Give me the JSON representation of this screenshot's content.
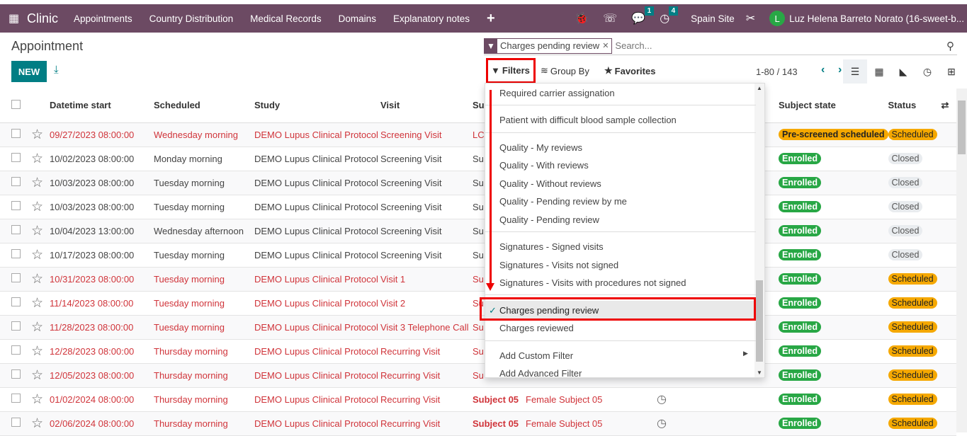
{
  "nav": {
    "app": "Clinic",
    "menus": [
      "Appointments",
      "Country Distribution",
      "Medical Records",
      "Domains",
      "Explanatory notes"
    ],
    "messages_count": "1",
    "activities_count": "4",
    "site": "Spain Site",
    "avatar_letter": "L",
    "user": "Luz Helena Barreto Norato (16-sweet-b..."
  },
  "page": {
    "title": "Appointment",
    "new_label": "NEW"
  },
  "search": {
    "facet": "Charges pending review",
    "placeholder": "Search..."
  },
  "controls": {
    "filters": "Filters",
    "group_by": "Group By",
    "favorites": "Favorites",
    "pager": "1-80 / 143"
  },
  "table": {
    "headers": [
      "Datetime start",
      "Scheduled",
      "Study",
      "Visit",
      "Su",
      "",
      "",
      "Subject state",
      "Status"
    ],
    "rows": [
      {
        "red": true,
        "date": "09/27/2023 08:00:00",
        "scheduled": "Wednesday morning",
        "study": "DEMO Lupus Clinical Protocol",
        "visit": "Screening Visit",
        "subject": "LC",
        "sex": "",
        "clock": false,
        "state": "Pre-screened scheduled",
        "status": "Scheduled"
      },
      {
        "red": false,
        "date": "10/02/2023 08:00:00",
        "scheduled": "Monday morning",
        "study": "DEMO Lupus Clinical Protocol",
        "visit": "Screening Visit",
        "subject": "Su",
        "sex": "",
        "clock": false,
        "state": "Enrolled",
        "status": "Closed"
      },
      {
        "red": false,
        "date": "10/03/2023 08:00:00",
        "scheduled": "Tuesday morning",
        "study": "DEMO Lupus Clinical Protocol",
        "visit": "Screening Visit",
        "subject": "Su",
        "sex": "",
        "clock": false,
        "state": "Enrolled",
        "status": "Closed"
      },
      {
        "red": false,
        "date": "10/03/2023 08:00:00",
        "scheduled": "Tuesday morning",
        "study": "DEMO Lupus Clinical Protocol",
        "visit": "Screening Visit",
        "subject": "Su",
        "sex": "",
        "clock": false,
        "state": "Enrolled",
        "status": "Closed"
      },
      {
        "red": false,
        "date": "10/04/2023 13:00:00",
        "scheduled": "Wednesday afternoon",
        "study": "DEMO Lupus Clinical Protocol",
        "visit": "Screening Visit",
        "subject": "Su",
        "sex": "",
        "clock": false,
        "state": "Enrolled",
        "status": "Closed"
      },
      {
        "red": false,
        "date": "10/17/2023 08:00:00",
        "scheduled": "Tuesday morning",
        "study": "DEMO Lupus Clinical Protocol",
        "visit": "Screening Visit",
        "subject": "Su",
        "sex": "",
        "clock": false,
        "state": "Enrolled",
        "status": "Closed"
      },
      {
        "red": true,
        "date": "10/31/2023 08:00:00",
        "scheduled": "Tuesday morning",
        "study": "DEMO Lupus Clinical Protocol",
        "visit": "Visit 1",
        "subject": "Su",
        "sex": "",
        "clock": false,
        "state": "Enrolled",
        "status": "Scheduled"
      },
      {
        "red": true,
        "date": "11/14/2023 08:00:00",
        "scheduled": "Tuesday morning",
        "study": "DEMO Lupus Clinical Protocol",
        "visit": "Visit 2",
        "subject": "Su",
        "sex": "",
        "clock": false,
        "state": "Enrolled",
        "status": "Scheduled"
      },
      {
        "red": true,
        "date": "11/28/2023 08:00:00",
        "scheduled": "Tuesday morning",
        "study": "DEMO Lupus Clinical Protocol",
        "visit": "Visit 3 Telephone Call",
        "subject": "Su",
        "sex": "",
        "clock": false,
        "state": "Enrolled",
        "status": "Scheduled"
      },
      {
        "red": true,
        "date": "12/28/2023 08:00:00",
        "scheduled": "Thursday morning",
        "study": "DEMO Lupus Clinical Protocol",
        "visit": "Recurring Visit",
        "subject": "Su",
        "sex": "",
        "clock": false,
        "state": "Enrolled",
        "status": "Scheduled"
      },
      {
        "red": true,
        "date": "12/05/2023 08:00:00",
        "scheduled": "Thursday morning",
        "study": "DEMO Lupus Clinical Protocol",
        "visit": "Recurring Visit",
        "subject": "Su",
        "sex": "",
        "clock": false,
        "state": "Enrolled",
        "status": "Scheduled"
      },
      {
        "red": true,
        "date": "01/02/2024 08:00:00",
        "scheduled": "Thursday morning",
        "study": "DEMO Lupus Clinical Protocol",
        "visit": "Recurring Visit",
        "subject": "Subject 05",
        "sex": "Female Subject 05",
        "clock": true,
        "state": "Enrolled",
        "status": "Scheduled"
      },
      {
        "red": true,
        "date": "02/06/2024 08:00:00",
        "scheduled": "Thursday morning",
        "study": "DEMO Lupus Clinical Protocol",
        "visit": "Recurring Visit",
        "subject": "Subject 05",
        "sex": "Female Subject 05",
        "clock": true,
        "state": "Enrolled",
        "status": "Scheduled"
      }
    ]
  },
  "filters_menu": {
    "items": [
      {
        "label": "Required carrier assignation",
        "checked": false
      },
      {
        "label": "Patient with difficult blood sample collection",
        "checked": false
      },
      {
        "label": "Quality - My reviews",
        "checked": false
      },
      {
        "label": "Quality - With reviews",
        "checked": false
      },
      {
        "label": "Quality - Without reviews",
        "checked": false
      },
      {
        "label": "Quality - Pending review by me",
        "checked": false
      },
      {
        "label": "Quality - Pending review",
        "checked": false
      },
      {
        "label": "Signatures - Signed visits",
        "checked": false
      },
      {
        "label": "Signatures - Visits not signed",
        "checked": false
      },
      {
        "label": "Signatures - Visits with procedures not signed",
        "checked": false
      },
      {
        "label": "Charges pending review",
        "checked": true
      },
      {
        "label": "Charges reviewed",
        "checked": false
      },
      {
        "label": "Add Custom Filter",
        "checked": false
      },
      {
        "label": "Add Advanced Filter",
        "checked": false
      }
    ]
  },
  "colors": {
    "navbar": "#6c4a63",
    "primary": "#017e84",
    "enrolled": "#28a745",
    "scheduled": "#f5a800",
    "highlight": "#e00000",
    "link_red": "#d0343a"
  }
}
